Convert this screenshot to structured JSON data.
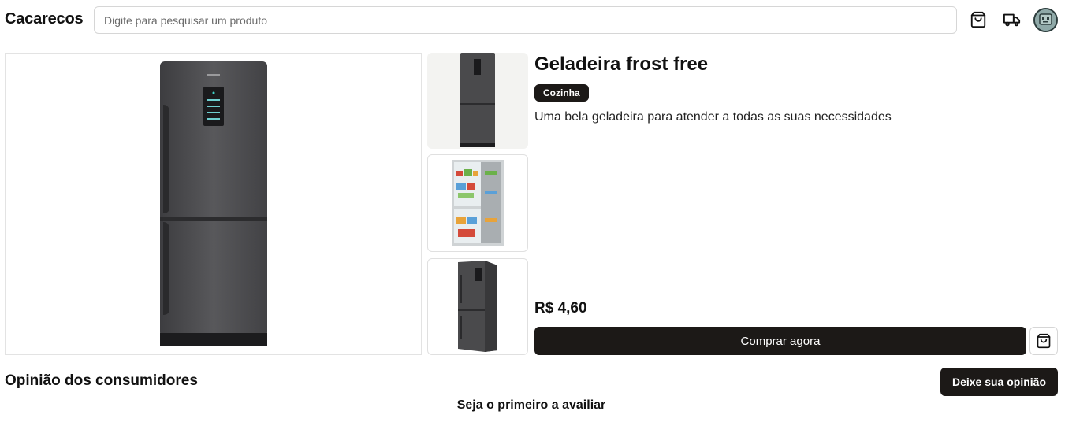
{
  "header": {
    "brand": "Cacarecos",
    "search_placeholder": "Digite para pesquisar um produto",
    "icons": [
      "shopping-bag-icon",
      "truck-icon",
      "avatar"
    ]
  },
  "product": {
    "title": "Geladeira frost free",
    "category": "Cozinha",
    "description": "Uma bela geladeira para atender a todas as suas necessidades",
    "price": "R$ 4,60",
    "buy_label": "Comprar agora",
    "images": [
      "refrigerator-front",
      "refrigerator-open",
      "refrigerator-angle"
    ]
  },
  "reviews": {
    "title": "Opinião dos consumidores",
    "button_label": "Deixe sua opinião",
    "empty_text": "Seja o primeiro a availiar"
  },
  "colors": {
    "primary": "#1c1917",
    "appliance": "#4a4a4c"
  }
}
